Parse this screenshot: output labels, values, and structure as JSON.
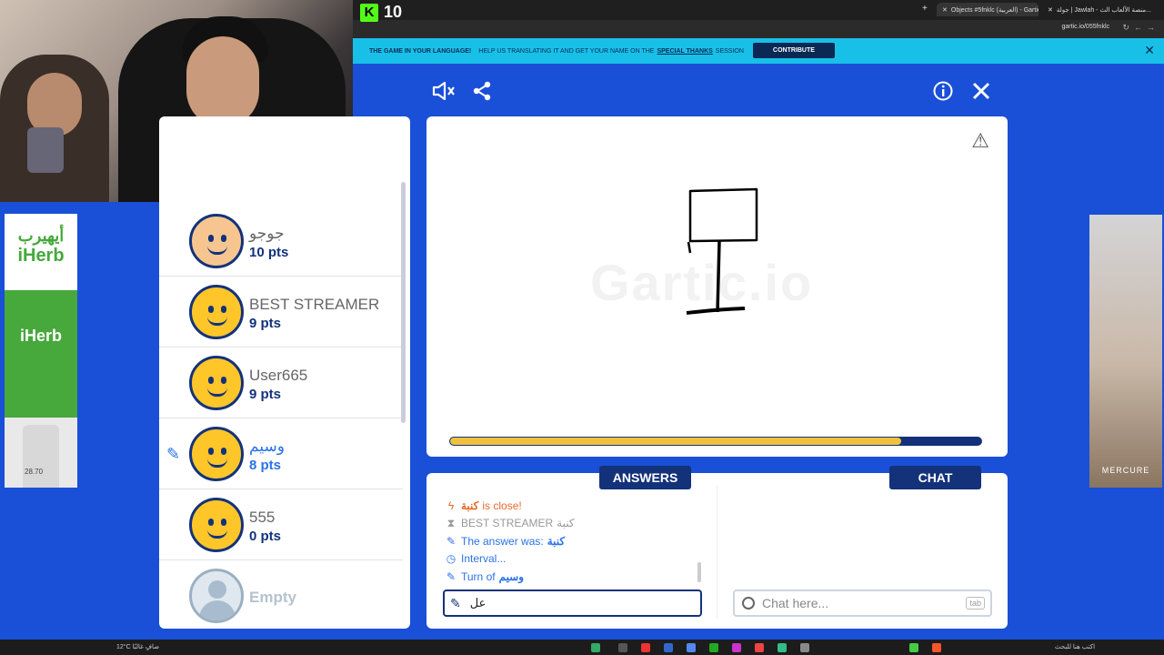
{
  "browser": {
    "tabs": [
      {
        "label": "Objects #5fnklc (العربية) - Gartic",
        "active": true
      },
      {
        "label": "جولة | Jawlah - منصة الألعاب الث...",
        "active": false
      }
    ],
    "url": "gartic.io/055fnklc"
  },
  "overlay": {
    "kick_logo": "K",
    "viewer_count": "10"
  },
  "banner": {
    "headline": "THE GAME IN YOUR LANGUAGE!",
    "text_before": "HELP US TRANSLATING IT AND GET YOUR NAME ON THE",
    "link_text": "SPECIAL THANKS",
    "text_after": "SESSION",
    "contribute_label": "CONTRIBUTE"
  },
  "players": [
    {
      "name": "جوجو",
      "points": "10 pts",
      "avatar": "special",
      "drawing": false
    },
    {
      "name": "BEST STREAMER",
      "points": "9 pts",
      "avatar": "default",
      "drawing": false
    },
    {
      "name": "User665",
      "points": "9 pts",
      "avatar": "default",
      "drawing": false
    },
    {
      "name": "وسيم",
      "points": "8 pts",
      "avatar": "default",
      "drawing": true
    },
    {
      "name": "555",
      "points": "0 pts",
      "avatar": "default",
      "drawing": false
    },
    {
      "name": "Empty",
      "points": "",
      "avatar": "empty",
      "drawing": false
    }
  ],
  "canvas": {
    "watermark": "Gartic.io",
    "timer_progress": 0.85
  },
  "answers": {
    "tab_label": "ANSWERS",
    "rows": [
      {
        "icon": "bolt-icon",
        "word": "كنبة",
        "text": "is close!",
        "style": "close"
      },
      {
        "icon": "hourglass-icon",
        "word": "BEST STREAMER",
        "text": "كنبة",
        "style": "hint"
      },
      {
        "icon": "pencil-icon",
        "word": "كنبة",
        "text": "The answer was:",
        "style": "info"
      },
      {
        "icon": "clock-icon",
        "word": "",
        "text": "Interval...",
        "style": "info"
      },
      {
        "icon": "pencil-icon",
        "word": "وسيم",
        "text": "Turn of",
        "style": "info"
      }
    ],
    "input_value": "عل"
  },
  "chat": {
    "tab_label": "CHAT",
    "placeholder": "Chat here...",
    "shortcut": "tab"
  },
  "ads": {
    "left_brand_ar": "أيهيرب",
    "left_brand_en": "iHerb",
    "left_price": "28.70",
    "right_brand": "MERCURE"
  },
  "taskbar": {
    "weather": "12°C صافٍ غالبًا",
    "search": "اكتب هنا للبحث"
  },
  "colors": {
    "background": "#1a4fd8",
    "navy": "#13327a",
    "accent": "#2a72e8",
    "close": "#e8682a",
    "timer": "#f0c13b",
    "banner": "#18c0e8"
  }
}
